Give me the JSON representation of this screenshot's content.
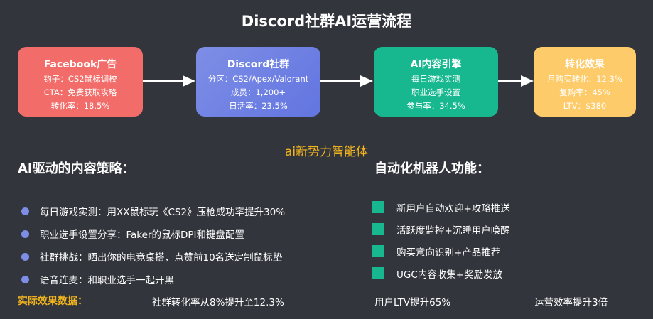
{
  "title": "Discord社群AI运营流程",
  "flow": {
    "facebook": {
      "title": "Facebook广告",
      "lines": [
        "钩子：CS2鼠标调校",
        "CTA：免费获取攻略",
        "转化率：18.5%"
      ]
    },
    "discord": {
      "title": "Discord社群",
      "lines": [
        "分区：CS2/Apex/Valorant",
        "成员：1,200+",
        "日活率：23.5%"
      ]
    },
    "ai_engine": {
      "title": "AI内容引擎",
      "lines": [
        "每日游戏实测",
        "职业选手设置",
        "参与率：34.5%"
      ]
    },
    "conversion": {
      "title": "转化效果",
      "lines": [
        "月购买转化：12.3%",
        "复购率：45%",
        "LTV：$380"
      ]
    }
  },
  "brand": "ai新势力智能体",
  "strategy": {
    "heading": "AI驱动的内容策略：",
    "items": [
      "每日游戏实测：用XX鼠标玩《CS2》压枪成功率提升30%",
      "职业选手设置分享：Faker的鼠标DPI和键盘配置",
      "社群挑战：晒出你的电竞桌搭，点赞前10名送定制鼠标垫",
      "语音连麦：和职业选手一起开黑"
    ]
  },
  "bot": {
    "heading": "自动化机器人功能：",
    "items": [
      "新用户自动欢迎+攻略推送",
      "活跃度监控+沉睡用户唤醒",
      "购买意向识别+产品推荐",
      "UGC内容收集+奖励发放"
    ]
  },
  "results": {
    "label": "实际效果数据：",
    "items": [
      "社群转化率从8%提升至12.3%",
      "用户LTV提升65%",
      "运营效率提升3倍"
    ]
  },
  "colors": {
    "background": "#33353c",
    "facebook": "#f26d69",
    "discord": "#6f82e3",
    "ai_engine": "#17b88f",
    "conversion": "#fecb6b",
    "accent_gold": "#f2b51d"
  }
}
